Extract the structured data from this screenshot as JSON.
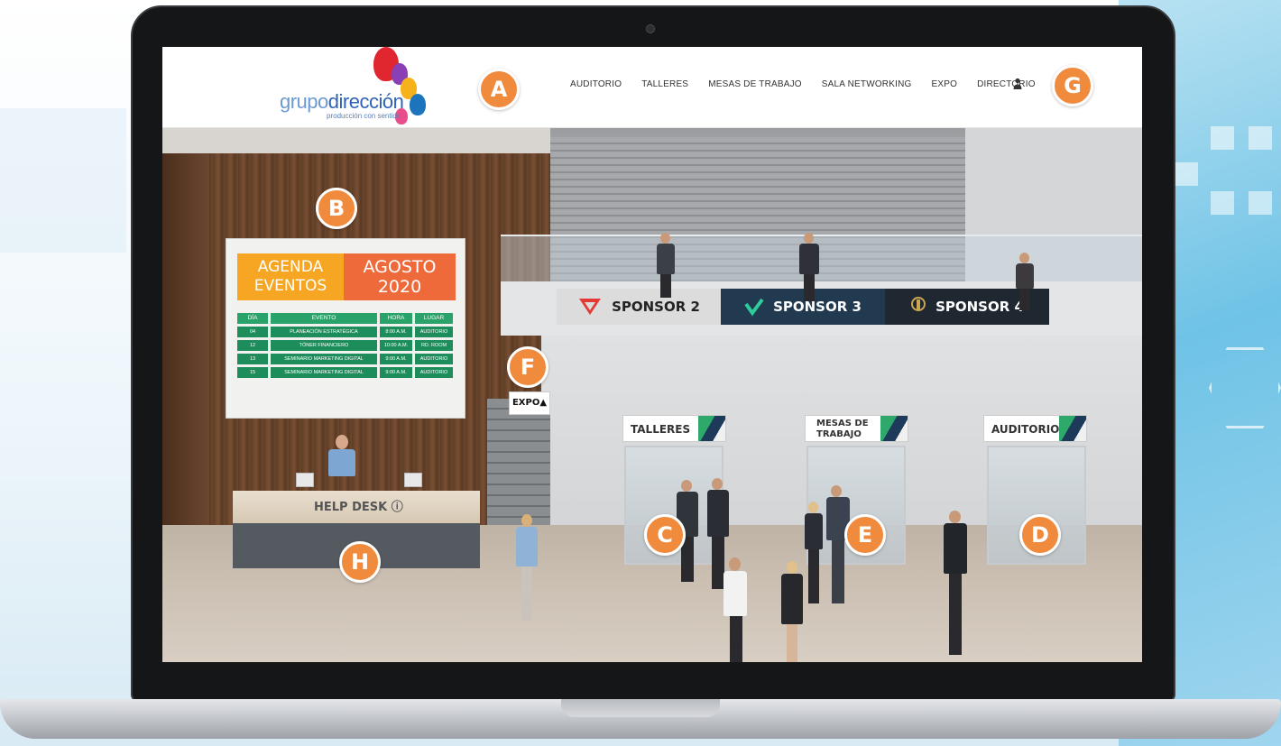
{
  "logo": {
    "text_light": "grupo",
    "text_bold": "dirección",
    "tagline": "producción con sentido"
  },
  "nav": {
    "items": [
      "AUDITORIO",
      "TALLERES",
      "MESAS DE TRABAJO",
      "SALA NETWORKING",
      "EXPO",
      "DIRECTORIO"
    ],
    "user_icon": "user-icon"
  },
  "markers": {
    "a": "A",
    "b": "B",
    "c": "C",
    "d": "D",
    "e": "E",
    "f": "F",
    "g": "G",
    "h": "H"
  },
  "agenda": {
    "title_left": "AGENDA EVENTOS",
    "title_right": "AGOSTO 2020",
    "headers": [
      "DÍA",
      "EVENTO",
      "HORA",
      "LUGAR"
    ],
    "rows": [
      [
        "04",
        "PLANEACIÓN ESTRATÉGICA",
        "8:00 A.M.",
        "AUDITORIO"
      ],
      [
        "12",
        "TÓNER FINANCIERO",
        "10:00 A.M.",
        "RD. ROOM"
      ],
      [
        "13",
        "SEMINARIO MARKETING DIGITAL",
        "9:00 A.M.",
        "AUDITORIO"
      ],
      [
        "15",
        "SEMINARIO MARKETING DIGITAL",
        "9:00 A.M.",
        "AUDITORIO"
      ]
    ]
  },
  "sponsors": [
    "SPONSOR 2",
    "SPONSOR 3",
    "SPONSOR 4"
  ],
  "signs": {
    "expo": "EXPO",
    "talleres": "TALLERES",
    "mesas_line1": "MESAS DE",
    "mesas_line2": "TRABAJO",
    "auditorio": "AUDITORIO",
    "helpdesk": "HELP DESK"
  },
  "colors": {
    "marker": "#f08a3c",
    "agenda_yellow": "#f6a623",
    "agenda_orange": "#ef6a3b",
    "agenda_green": "#1e8d5c"
  }
}
